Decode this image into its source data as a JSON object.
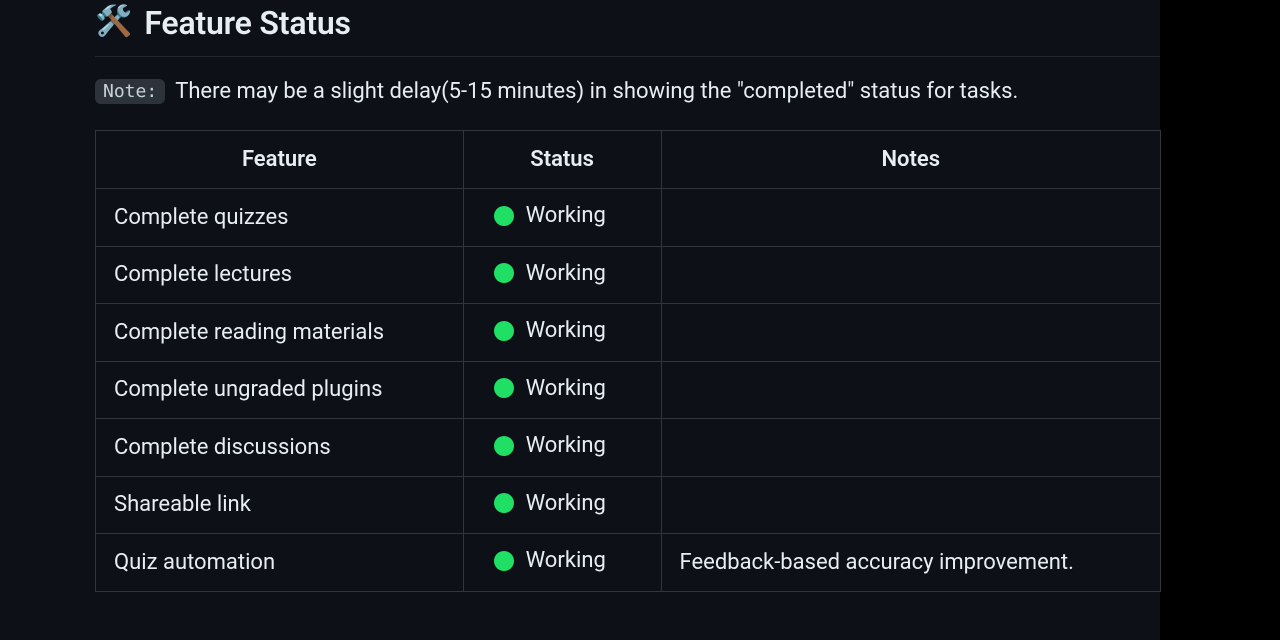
{
  "header": {
    "icon": "🛠️",
    "title": "Feature Status"
  },
  "note": {
    "badge": "Note:",
    "text": "There may be a slight delay(5-15 minutes) in showing the \"completed\" status for tasks."
  },
  "table": {
    "headers": {
      "feature": "Feature",
      "status": "Status",
      "notes": "Notes"
    },
    "rows": [
      {
        "feature": "Complete quizzes",
        "status": "Working",
        "status_color": "green",
        "notes": ""
      },
      {
        "feature": "Complete lectures",
        "status": "Working",
        "status_color": "green",
        "notes": ""
      },
      {
        "feature": "Complete reading materials",
        "status": "Working",
        "status_color": "green",
        "notes": ""
      },
      {
        "feature": "Complete ungraded plugins",
        "status": "Working",
        "status_color": "green",
        "notes": ""
      },
      {
        "feature": "Complete discussions",
        "status": "Working",
        "status_color": "green",
        "notes": ""
      },
      {
        "feature": "Shareable link",
        "status": "Working",
        "status_color": "green",
        "notes": ""
      },
      {
        "feature": "Quiz automation",
        "status": "Working",
        "status_color": "green",
        "notes": "Feedback-based accuracy improvement."
      }
    ]
  }
}
